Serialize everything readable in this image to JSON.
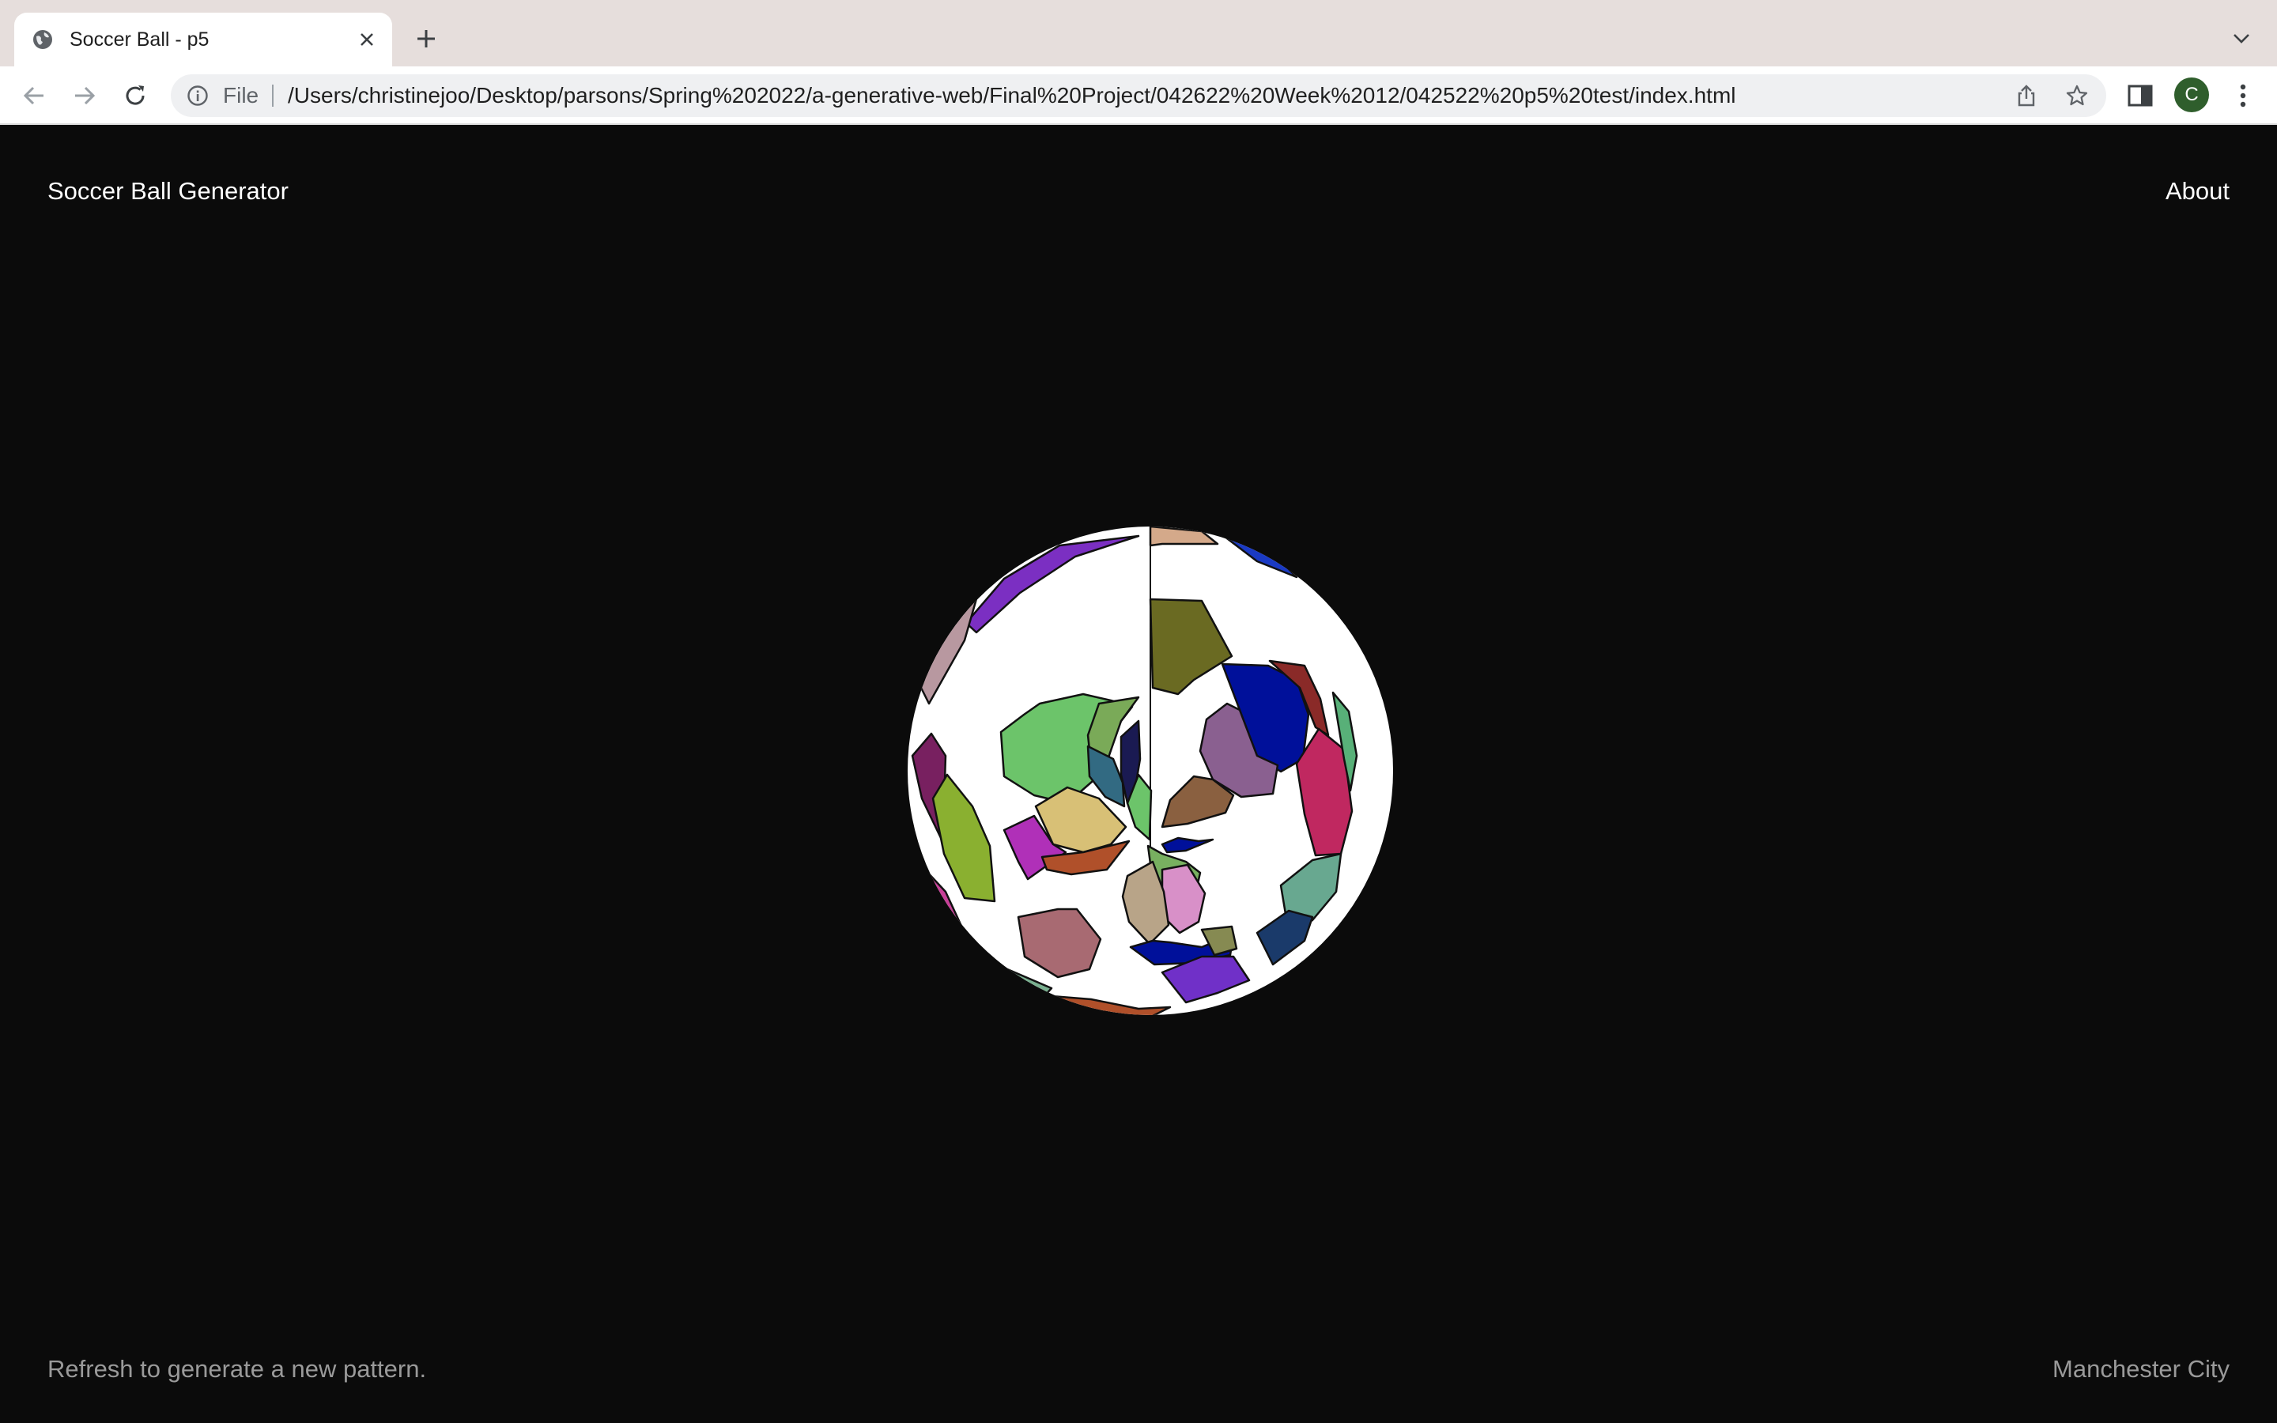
{
  "browser": {
    "tab_title": "Soccer Ball - p5",
    "omnibox_scheme": "File",
    "url": "/Users/christinejoo/Desktop/parsons/Spring%202022/a-generative-web/Final%20Project/042622%20Week%2012/042522%20p5%20test/index.html",
    "profile_initial": "C",
    "profile_color": "#2f5e2c"
  },
  "page": {
    "title": "Soccer Ball Generator",
    "nav_about": "About",
    "footer_hint": "Refresh to generate a new pattern.",
    "footer_team": "Manchester City",
    "background_color": "#0b0b0b",
    "ball_base_color": "#ffffff"
  }
}
